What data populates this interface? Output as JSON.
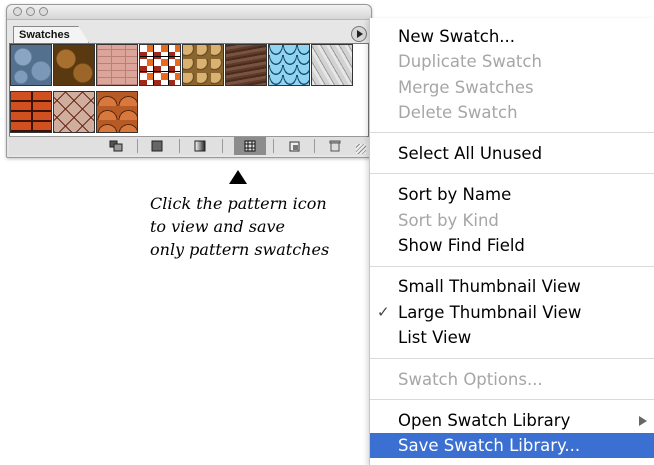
{
  "palette": {
    "tab_label": "Swatches",
    "window_buttons": [
      "close",
      "minimize",
      "zoom"
    ],
    "swatches": [
      {
        "name": "blue-stone",
        "color": "#6a86a6"
      },
      {
        "name": "brown-stone",
        "color": "#8c5a22"
      },
      {
        "name": "pink-brick",
        "color": "#d79c8e"
      },
      {
        "name": "checker-tiles",
        "color": "#ffffff"
      },
      {
        "name": "tan-pebbles",
        "color": "#c59a5a"
      },
      {
        "name": "wood-grain",
        "color": "#6e4634"
      },
      {
        "name": "blue-waves",
        "color": "#8fd2f0"
      },
      {
        "name": "gray-marble",
        "color": "#cfcfcf"
      },
      {
        "name": "orange-brick-weave",
        "color": "#c2421c"
      },
      {
        "name": "diamond-lattice",
        "color": "#c6a08f"
      },
      {
        "name": "orange-scales",
        "color": "#c86a32"
      }
    ],
    "toolbar_icons": [
      "show-all-swatches-icon",
      "show-color-swatches-icon",
      "show-gradient-swatches-icon",
      "show-pattern-swatches-icon",
      "new-swatch-icon",
      "delete-swatch-icon"
    ],
    "selected_filter": "show-pattern-swatches-icon"
  },
  "callout": {
    "lines": [
      "Click the pattern icon",
      "to view and save",
      "only pattern swatches"
    ]
  },
  "menu": {
    "items": [
      {
        "label": "New Swatch...",
        "enabled": true
      },
      {
        "label": "Duplicate Swatch",
        "enabled": false
      },
      {
        "label": "Merge Swatches",
        "enabled": false
      },
      {
        "label": "Delete Swatch",
        "enabled": false
      },
      {
        "label": "Select All Unused",
        "enabled": true
      },
      {
        "label": "Sort by Name",
        "enabled": true
      },
      {
        "label": "Sort by Kind",
        "enabled": false
      },
      {
        "label": "Show Find Field",
        "enabled": true
      },
      {
        "label": "Small Thumbnail View",
        "enabled": true
      },
      {
        "label": "Large Thumbnail View",
        "enabled": true,
        "checked": true
      },
      {
        "label": "List View",
        "enabled": true
      },
      {
        "label": "Swatch Options...",
        "enabled": false
      },
      {
        "label": "Open Swatch Library",
        "enabled": true,
        "submenu": true
      },
      {
        "label": "Save Swatch Library...",
        "enabled": true,
        "highlighted": true
      }
    ],
    "check_glyph": "✓",
    "highlight_color": "#3b6fd1",
    "disabled_color": "#a6a6a6"
  }
}
